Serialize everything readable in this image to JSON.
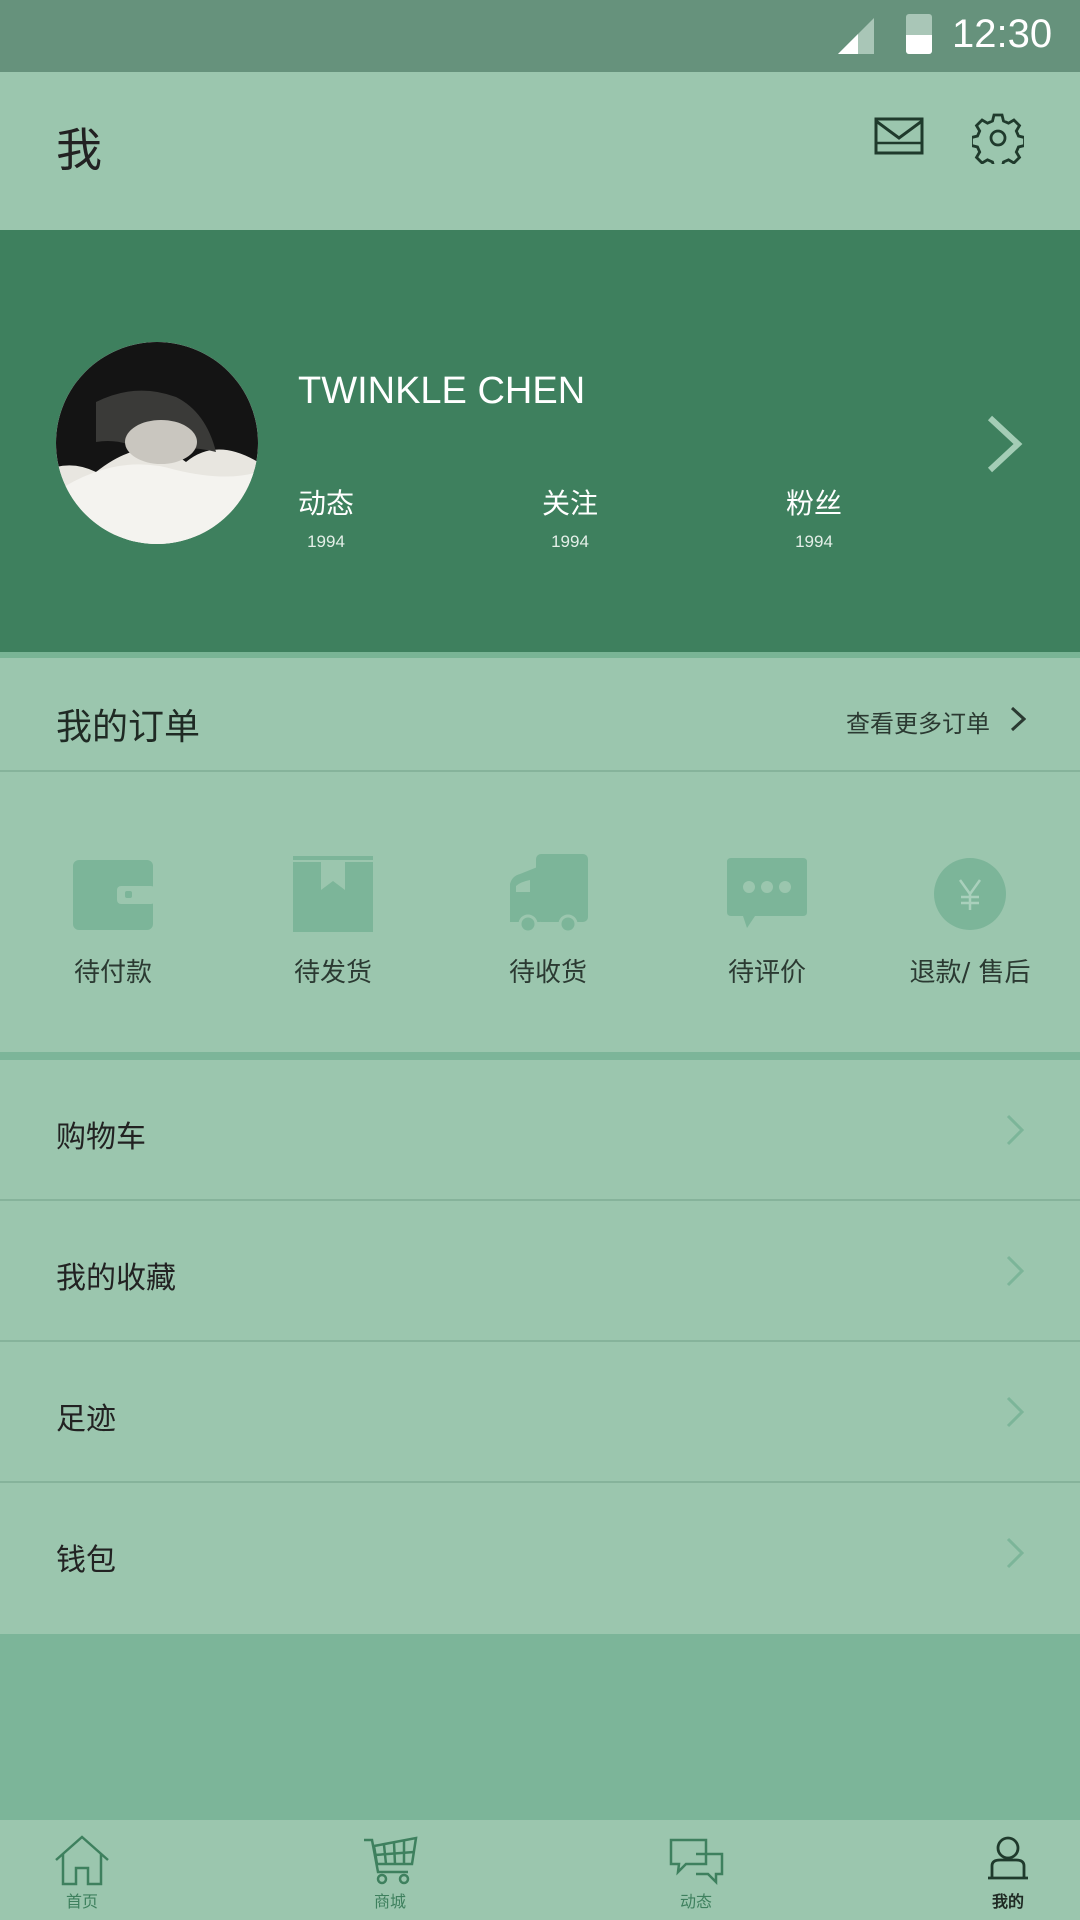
{
  "status_bar": {
    "time": "12:30",
    "battery_level": 0.48,
    "icons": [
      "signal-icon",
      "battery-icon"
    ]
  },
  "header": {
    "title": "我",
    "icons": [
      "mail-icon",
      "settings-icon"
    ]
  },
  "profile": {
    "name": "TWINKLE CHEN",
    "stats": [
      {
        "label": "动态",
        "value": "1994"
      },
      {
        "label": "关注",
        "value": "1994"
      },
      {
        "label": "粉丝",
        "value": "1994"
      }
    ]
  },
  "orders": {
    "title": "我的订单",
    "more": "查看更多订单",
    "items": [
      {
        "label": "待付款",
        "icon": "wallet-icon"
      },
      {
        "label": "待发货",
        "icon": "package-icon"
      },
      {
        "label": "待收货",
        "icon": "truck-icon"
      },
      {
        "label": "待评价",
        "icon": "comment-icon"
      },
      {
        "label": "退款/ 售后",
        "icon": "refund-icon"
      }
    ]
  },
  "menu": [
    {
      "label": "购物车"
    },
    {
      "label": "我的收藏"
    },
    {
      "label": "足迹"
    },
    {
      "label": "钱包"
    }
  ],
  "tabs": [
    {
      "label": "首页",
      "icon": "home-icon"
    },
    {
      "label": "商城",
      "icon": "cart-icon"
    },
    {
      "label": "动态",
      "icon": "chat-icon"
    },
    {
      "label": "我的",
      "icon": "user-icon",
      "active": true
    }
  ],
  "colors": {
    "accent": "#3e805e",
    "background": "#9bc6ae",
    "status_bar": "#66927c",
    "icon_fill": "#7cb599"
  }
}
